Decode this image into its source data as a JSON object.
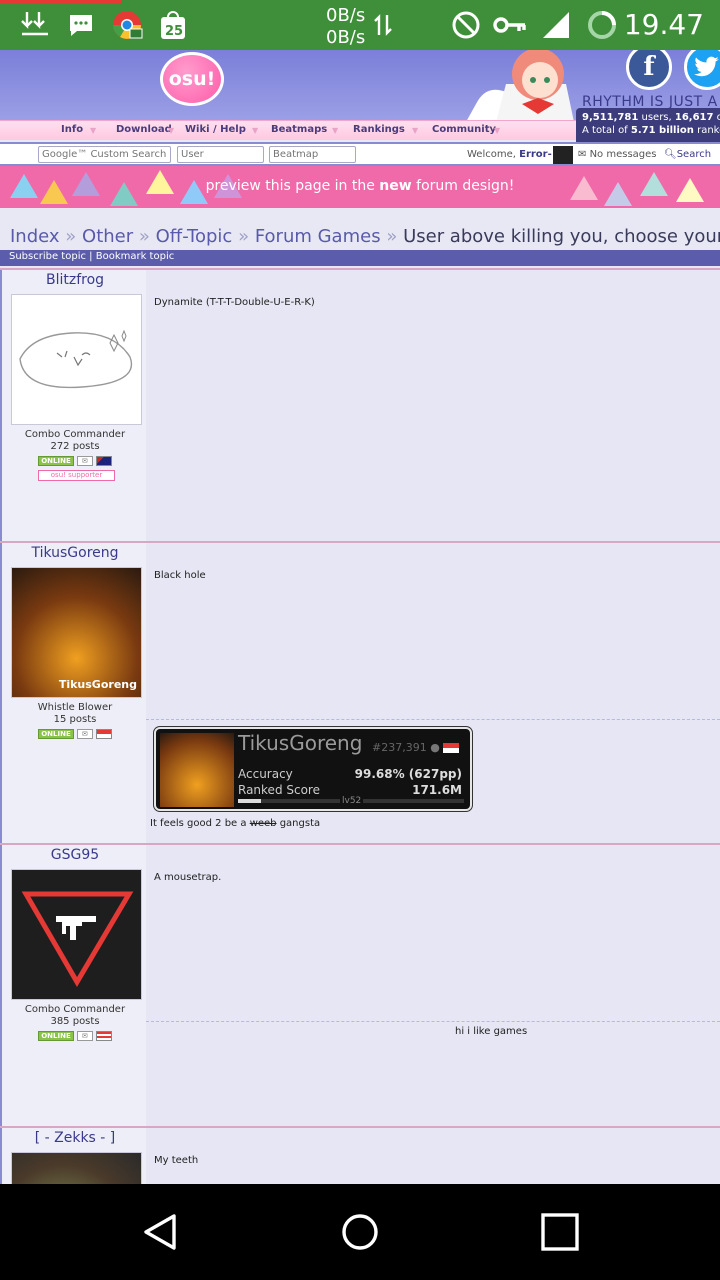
{
  "status_bar": {
    "net_up": "0B/s",
    "net_down": "0B/s",
    "notification_count": "25",
    "time": "19.47",
    "icons": [
      "download-icon",
      "chat-icon",
      "chrome-icon",
      "bag-icon",
      "blocked-icon",
      "key-icon",
      "signal-icon",
      "battery-icon"
    ]
  },
  "header": {
    "logo": "osu!",
    "tagline": "RHYTHM IS JUST A",
    "social": {
      "facebook": "f",
      "twitter": "t"
    },
    "stats": {
      "users": "9,511,781",
      "users_suffix": " users, ",
      "online": "16,617",
      "online_suffix": " onlin",
      "ranked_prefix": "A total of ",
      "ranked": "5.71 billion",
      "ranked_suffix": " ranked p"
    }
  },
  "nav": {
    "items": [
      "Info",
      "Download",
      "Wiki / Help",
      "Beatmaps",
      "Rankings",
      "Community"
    ]
  },
  "search": {
    "google_placeholder": "Google™ Custom Search",
    "user_placeholder": "User",
    "beatmap_placeholder": "Beatmap",
    "welcome_prefix": "Welcome, ",
    "username": "Error-",
    "messages": "No messages",
    "search_link": "Search"
  },
  "new_design": {
    "prefix": "preview this page in the ",
    "bold": "new",
    "suffix": " forum design!"
  },
  "breadcrumb": {
    "items": [
      "Index",
      "Other",
      "Off-Topic",
      "Forum Games"
    ],
    "separator": "»",
    "current": "User above killing you, choose your weapon"
  },
  "topic_actions": {
    "subscribe": "Subscribe topic",
    "divider": " | ",
    "bookmark": "Bookmark topic"
  },
  "posts": [
    {
      "username": "Blitzfrog",
      "title": "Combo Commander",
      "posts": "272 posts",
      "online": "ONLINE",
      "supporter": "osu! supporter",
      "text": "Dynamite (T-T-T-Double-U-E-R-K)"
    },
    {
      "username": "TikusGoreng",
      "title": "Whistle Blower",
      "posts": "15 posts",
      "online": "ONLINE",
      "text": "Black hole",
      "signature": {
        "name": "TikusGoreng",
        "rank": "#237,391",
        "accuracy_label": "Accuracy",
        "accuracy_value": "99.68% (627pp)",
        "score_label": "Ranked Score",
        "score_value": "171.6M",
        "level": "lv52",
        "level_progress": 0.1,
        "sig_text_prefix": "It feels good 2 be a ",
        "sig_text_strike": "weeb",
        "sig_text_suffix": " gangsta",
        "avatar_text": "TikusGoreng"
      }
    },
    {
      "username": "GSG95",
      "title": "Combo Commander",
      "posts": "385 posts",
      "online": "ONLINE",
      "text": "A mousetrap.",
      "signature_text": "hi i like games"
    },
    {
      "username": "[ - Zekks - ]",
      "text": "My teeth"
    }
  ],
  "colors": {
    "status_bar": "#3f8f3a",
    "banner": "#7b7fd8",
    "pink": "#f06aaa",
    "link": "#5a5aaa",
    "topic_bar": "#5c5cad"
  }
}
